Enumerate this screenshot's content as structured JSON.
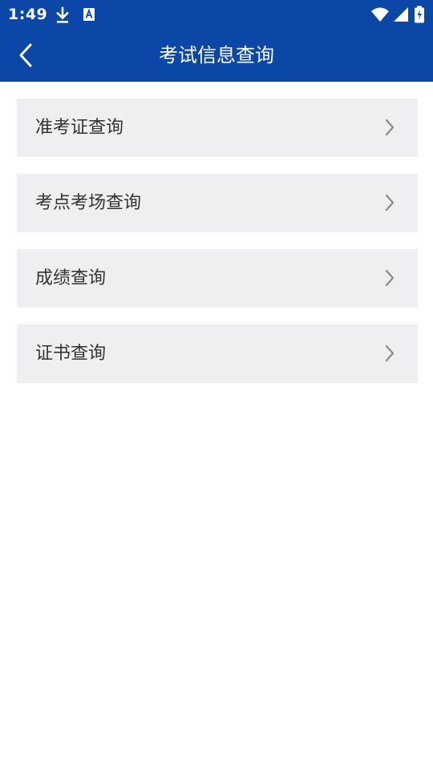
{
  "status_bar": {
    "time": "1:49",
    "icons": [
      "download-icon",
      "a-icon",
      "wifi-icon",
      "signal-icon",
      "battery-icon"
    ]
  },
  "app_bar": {
    "title": "考试信息查询",
    "back_icon": "chevron-left-icon",
    "color": "#0a47a6"
  },
  "menu": {
    "items": [
      {
        "label": "准考证查询"
      },
      {
        "label": "考点考场查询"
      },
      {
        "label": "成绩查询"
      },
      {
        "label": "证书查询"
      }
    ],
    "item_background": "#efeff1",
    "chevron_icon": "chevron-right-icon"
  }
}
